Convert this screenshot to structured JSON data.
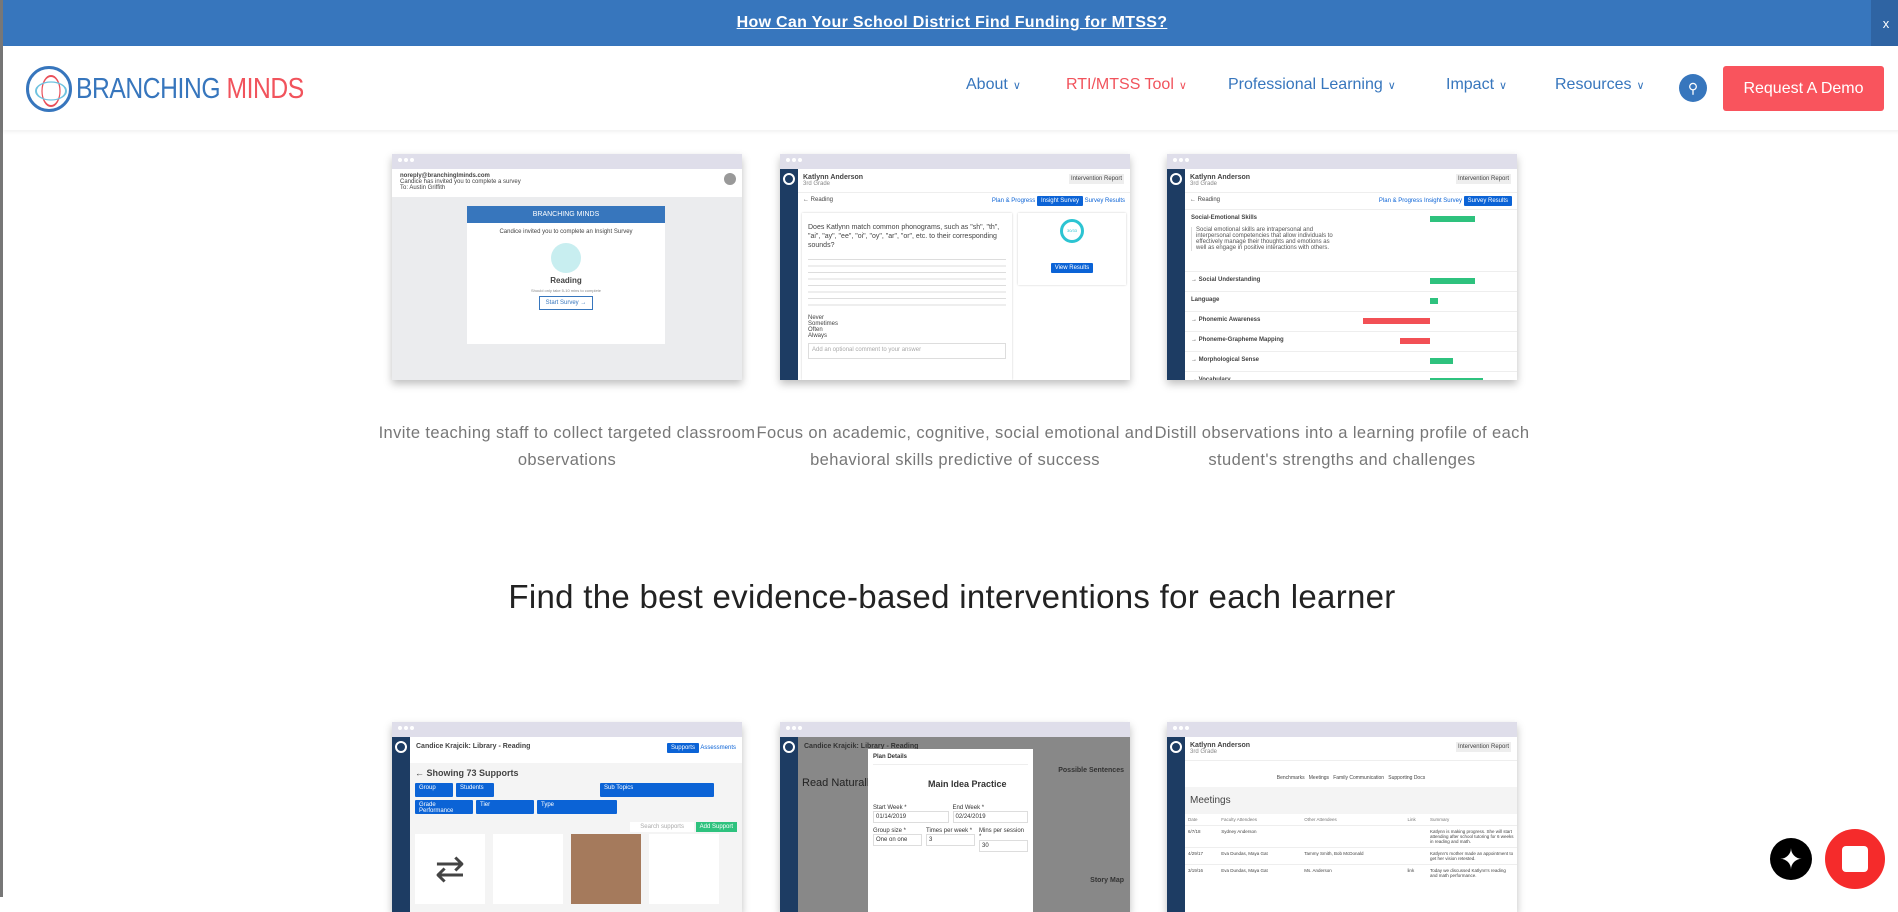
{
  "banner": {
    "link": "How Can Your School District Find Funding for MTSS?",
    "close": "x"
  },
  "header": {
    "logo_a": "BRANCHING",
    "logo_b": " MINDS",
    "nav": [
      {
        "label": "About"
      },
      {
        "label": "RTI/MTSS Tool"
      },
      {
        "label": "Professional Learning"
      },
      {
        "label": "Impact"
      },
      {
        "label": "Resources"
      }
    ],
    "chevron": "∨",
    "search_icon": "search-icon",
    "cta": "Request A Demo"
  },
  "row1": [
    {
      "email": "noreply@branchinglminds.com",
      "line": "Candice has invited you to complete a survey",
      "to": "To: Austin Griffith",
      "brand": "BRANCHING MINDS",
      "invite": "Candice invited you to complete an Insight Survey",
      "subject": "Reading",
      "duration": "Should only take 5-10 mins to complete",
      "button": "Start Survey →",
      "caption": "Invite teaching staff to collect targeted classroom observations"
    },
    {
      "student": "Katlynn Anderson",
      "grade": "3rd Grade",
      "report": "Intervention Report",
      "crumb": "← Reading",
      "tabs": [
        "Plan & Progress",
        "Insight Survey",
        "Survey Results"
      ],
      "question": "Does Katlynn match common phonograms, such as \"sh\", \"th\", \"ai\", \"ay\", \"ee\", \"oi\", \"oy\", \"ar\", \"or\", etc. to their corresponding sounds?",
      "options": [
        "Never",
        "Sometimes",
        "Often",
        "Always"
      ],
      "comment_placeholder": "Add an optional comment to your answer",
      "progress": "30/33",
      "results_btn": "View Results",
      "caption": "Focus on academic, cognitive, social emotional and behavioral skills predictive of success"
    },
    {
      "student": "Katlynn Anderson",
      "grade": "3rd Grade",
      "report": "Intervention Report",
      "crumb": "← Reading",
      "tabs": [
        "Plan & Progress",
        "Insight Survey",
        "Survey Results"
      ],
      "desc": "Social emotional skills are intrapersonal and interpersonal competencies that allow individuals to effectively manage their thoughts and emotions as well as engage in positive interactions with others.",
      "skills": [
        {
          "label": "Social-Emotional Skills",
          "value": 0.6,
          "color": "#2ec27e"
        },
        {
          "label": "→ Social Understanding",
          "value": 0.6,
          "color": "#2ec27e"
        },
        {
          "label": "Language",
          "value": 0.1,
          "color": "#2ec27e"
        },
        {
          "label": "→ Phonemic Awareness",
          "value": -0.9,
          "color": "#f25055"
        },
        {
          "label": "→ Phoneme-Grapheme Mapping",
          "value": -0.4,
          "color": "#f25055"
        },
        {
          "label": "→ Morphological Sense",
          "value": 0.3,
          "color": "#2ec27e"
        },
        {
          "label": "→ Vocabulary",
          "value": 0.7,
          "color": "#2ec27e"
        }
      ],
      "caption": "Distill observations into a learning profile of each student's strengths and challenges"
    }
  ],
  "heading": "Find the best evidence-based interventions for each learner",
  "row2": [
    {
      "title": "Candice Krajcik: Library - Reading",
      "tabs": [
        "Supports",
        "Assessments"
      ],
      "showing": "← Showing 73 Supports",
      "filters": [
        "Group",
        "Students",
        "Sub Topics",
        "Grade Performance",
        "Tier",
        "Type"
      ],
      "search": "Search supports",
      "add": "Add Support"
    },
    {
      "title": "Candice Krajcik: Library - Reading",
      "modal": "Plan Details",
      "plan": "Main Idea Practice",
      "left": "Read Naturally",
      "right": [
        "Possible Sentences",
        "Story Map"
      ],
      "fields": [
        "Start Week *",
        "End Week *",
        "Group size *",
        "Times per week *",
        "Mins per session *"
      ],
      "values": [
        "01/14/2019",
        "02/24/2019",
        "One on one",
        "3",
        "30"
      ]
    },
    {
      "student": "Katlynn Anderson",
      "grade": "3rd Grade",
      "report": "Intervention Report",
      "pills": [
        "Benchmarks",
        "Meetings",
        "Family Communication",
        "Supporting Docs"
      ],
      "section": "Meetings",
      "cols": [
        "Date",
        "Faculty Attendees",
        "Other Attendees",
        "Link",
        "Summary"
      ],
      "rows": [
        [
          "6/7/18",
          "Sydney Anderson",
          "",
          "",
          "Katlynn is making progress. She will start attending after school tutoring for 6 weeks in reading and math."
        ],
        [
          "4/29/17",
          "Eva Dundas, Maya Gat",
          "Tammy Smith, Bob McDonald",
          "",
          "Katlynn's mother made an appointment to get her vision retested."
        ],
        [
          "3/19/16",
          "Eva Dundas, Maya Gat",
          "Ms. Anderson",
          "link",
          "Today we discussed Katlynn's reading and math performance."
        ]
      ]
    }
  ],
  "widgets": {
    "accessibility": "accessibility-icon",
    "chat": "chat-icon"
  }
}
